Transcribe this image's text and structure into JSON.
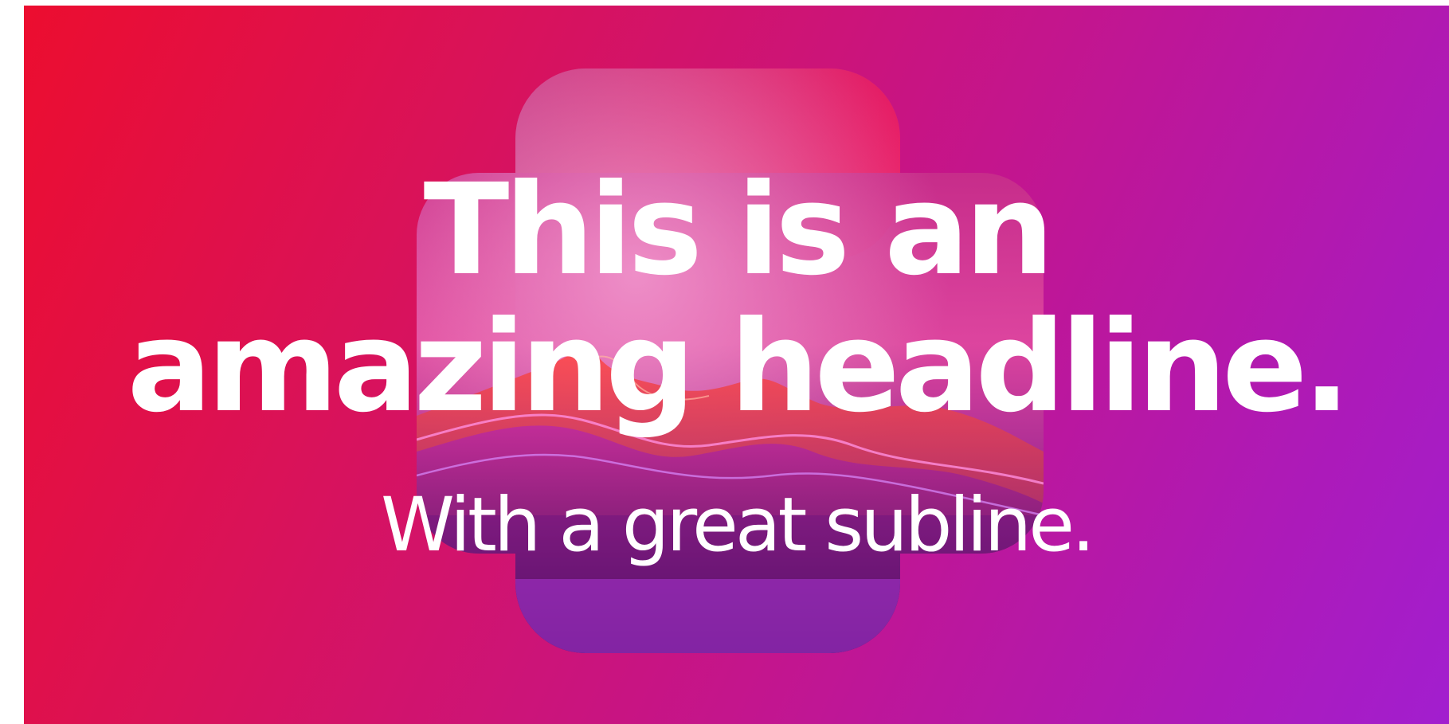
{
  "banner": {
    "headline_line1": "This is an",
    "headline_line2": "amazing headline.",
    "subline": "With a great subline."
  },
  "colors": {
    "gradient_start": "#ec0d2f",
    "gradient_mid": "#c3158e",
    "gradient_end": "#a21ecf",
    "text": "#ffffff"
  },
  "icons": {
    "hero_art": "abstract-mountain-landscape-icon"
  }
}
